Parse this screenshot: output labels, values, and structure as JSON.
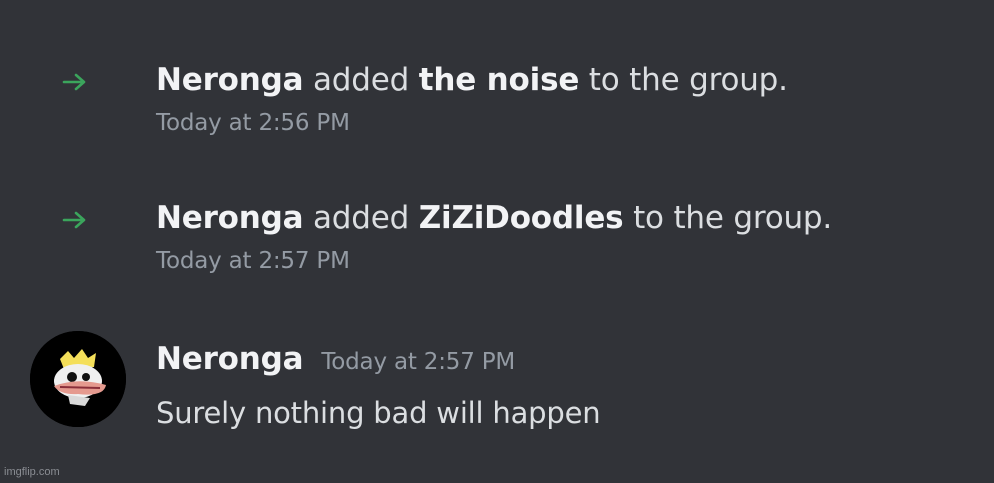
{
  "messages": [
    {
      "type": "system",
      "icon": "arrow-right-icon",
      "actor": "Neronga",
      "verb": "added",
      "target": "the noise",
      "suffix": "to the group.",
      "timestamp": "Today at 2:56 PM"
    },
    {
      "type": "system",
      "icon": "arrow-right-icon",
      "actor": "Neronga",
      "verb": "added",
      "target": "ZiZiDoodles",
      "suffix": "to the group.",
      "timestamp": "Today at 2:57 PM"
    },
    {
      "type": "user",
      "author": "Neronga",
      "timestamp": "Today at 2:57 PM",
      "content": "Surely nothing bad will happen"
    }
  ],
  "watermark": "imgflip.com",
  "colors": {
    "background": "#313338",
    "arrow": "#3ba55c",
    "text": "#dbdee1",
    "name": "#f2f3f5",
    "muted": "#949ba4"
  }
}
